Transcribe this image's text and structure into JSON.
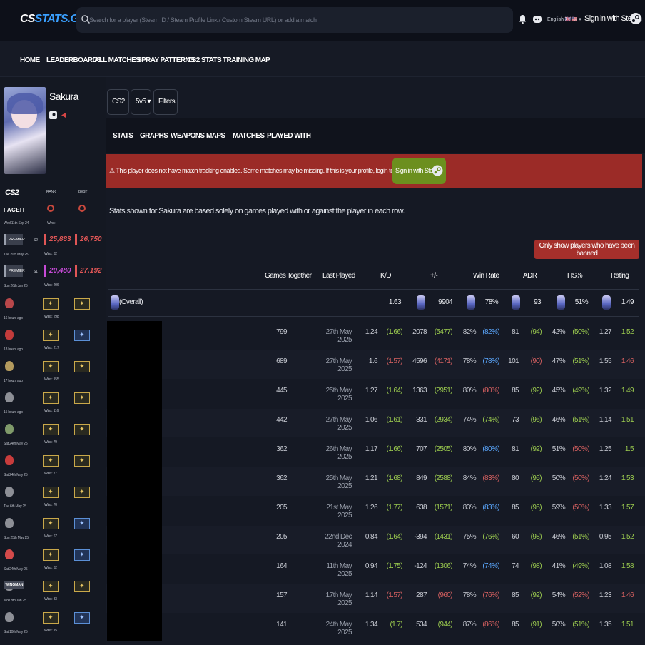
{
  "header": {
    "logo_cs": "CS",
    "logo_stats": "STATS.GG",
    "search_placeholder": "Search for a player (Steam ID / Steam Profile Link / Custom Steam URL) or add a match",
    "language": "English 🇬🇧🇺🇸 ▾",
    "signin": "Sign in with Steam"
  },
  "nav": [
    "HOME",
    "LEADERBOARDS",
    "ALL MATCHES",
    "SPRAY PATTERNS",
    "CS2 STATS",
    "TRAINING MAP"
  ],
  "profile": {
    "name": "Sakura",
    "cs2_label": "CS2",
    "rank_col": "RANK",
    "best_col": "BEST",
    "faceit_label": "FACEIT",
    "faceit_wins": "Wins:",
    "faceit_date": "Wed 11th Sep 24",
    "premier": [
      {
        "season": "S2",
        "rating": "25,883",
        "best": "26,750",
        "wins": "Wins: 32",
        "date": "Tue 20th May 25",
        "label": "PREMIER"
      },
      {
        "season": "S1",
        "rating": "20,480",
        "best": "27,192",
        "wins": "Wins: 206",
        "date": "Sun 26th Jan 25",
        "label": "PREMIER"
      }
    ],
    "maps": [
      {
        "date": "16 hours ago",
        "wins": "Wins: 298"
      },
      {
        "date": "18 hours ago",
        "wins": "Wins: 217"
      },
      {
        "date": "17 hours ago",
        "wins": "Wins: 155"
      },
      {
        "date": "15 hours ago",
        "wins": "Wins: 116"
      },
      {
        "date": "Sat 24th May 25",
        "wins": "Wins: 79"
      },
      {
        "date": "Sat 24th May 25",
        "wins": "Wins: 77"
      },
      {
        "date": "Tue 6th May 25",
        "wins": "Wins: 70"
      },
      {
        "date": "Sun 25th May 25",
        "wins": "Wins: 67"
      },
      {
        "date": "Sat 24th May 25",
        "wins": "Wins: 62"
      },
      {
        "date": "Mon 8th Jan 25",
        "wins": "Wins: 33"
      },
      {
        "date": "Sat 10th May 25",
        "wins": "Wins: 15"
      }
    ],
    "wingman_label": "WINGMAN"
  },
  "filters": {
    "game": "CS2 ▾",
    "mode": "5v5 ▾",
    "filters": "Filters ⋮"
  },
  "tabs": [
    "STATS",
    "GRAPHS",
    "WEAPONS",
    "MAPS",
    "MATCHES",
    "PLAYED WITH"
  ],
  "alert": {
    "text": "⚠ This player does not have match tracking enabled. Some matches may be missing. If this is your profile, login to set this up",
    "button": "Sign in with Steam"
  },
  "info": "Stats shown for Sakura are based solely on games played with or against the player in each row.",
  "banned_button": "Only show players who have been banned",
  "columns": [
    "Games Together",
    "Last Played",
    "K/D",
    "+/-",
    "Win Rate",
    "ADR",
    "HS%",
    "Rating"
  ],
  "overall": {
    "label": "(Overall)",
    "kd": "1.63",
    "pm": "9904",
    "wr": "78%",
    "adr": "93",
    "hs": "51%",
    "rating": "1.49"
  },
  "rows": [
    {
      "games": "799",
      "last": "27th May 2025",
      "kd": "1.24",
      "kd2": "(1.66)",
      "pm": "2078",
      "pm2": "(5477)",
      "wr": "82%",
      "wr2": "(82%)",
      "adr": "81",
      "adr2": "(94)",
      "hs": "42%",
      "hs2": "(50%)",
      "r": "1.27",
      "r2": "1.52"
    },
    {
      "games": "689",
      "last": "27th May 2025",
      "kd": "1.6",
      "kd2": "(1.57)",
      "pm": "4596",
      "pm2": "(4171)",
      "wr": "78%",
      "wr2": "(78%)",
      "adr": "101",
      "adr2": "(90)",
      "hs": "47%",
      "hs2": "(51%)",
      "r": "1.55",
      "r2": "1.46"
    },
    {
      "games": "445",
      "last": "25th May 2025",
      "kd": "1.27",
      "kd2": "(1.64)",
      "pm": "1363",
      "pm2": "(2951)",
      "wr": "80%",
      "wr2": "(80%)",
      "adr": "85",
      "adr2": "(92)",
      "hs": "45%",
      "hs2": "(49%)",
      "r": "1.32",
      "r2": "1.49"
    },
    {
      "games": "442",
      "last": "27th May 2025",
      "kd": "1.06",
      "kd2": "(1.61)",
      "pm": "331",
      "pm2": "(2934)",
      "wr": "74%",
      "wr2": "(74%)",
      "adr": "73",
      "adr2": "(96)",
      "hs": "46%",
      "hs2": "(51%)",
      "r": "1.14",
      "r2": "1.51"
    },
    {
      "games": "362",
      "last": "26th May 2025",
      "kd": "1.17",
      "kd2": "(1.66)",
      "pm": "707",
      "pm2": "(2505)",
      "wr": "80%",
      "wr2": "(80%)",
      "adr": "81",
      "adr2": "(92)",
      "hs": "51%",
      "hs2": "(50%)",
      "r": "1.25",
      "r2": "1.5"
    },
    {
      "games": "362",
      "last": "25th May 2025",
      "kd": "1.21",
      "kd2": "(1.68)",
      "pm": "849",
      "pm2": "(2588)",
      "wr": "84%",
      "wr2": "(83%)",
      "adr": "80",
      "adr2": "(95)",
      "hs": "50%",
      "hs2": "(50%)",
      "r": "1.24",
      "r2": "1.53"
    },
    {
      "games": "205",
      "last": "21st May 2025",
      "kd": "1.26",
      "kd2": "(1.77)",
      "pm": "638",
      "pm2": "(1571)",
      "wr": "83%",
      "wr2": "(83%)",
      "adr": "85",
      "adr2": "(95)",
      "hs": "59%",
      "hs2": "(50%)",
      "r": "1.33",
      "r2": "1.57"
    },
    {
      "games": "205",
      "last": "22nd Dec 2024",
      "kd": "0.84",
      "kd2": "(1.64)",
      "pm": "-394",
      "pm2": "(1431)",
      "wr": "75%",
      "wr2": "(76%)",
      "adr": "60",
      "adr2": "(98)",
      "hs": "46%",
      "hs2": "(51%)",
      "r": "0.95",
      "r2": "1.52"
    },
    {
      "games": "164",
      "last": "11th May 2025",
      "kd": "0.94",
      "kd2": "(1.75)",
      "pm": "-124",
      "pm2": "(1306)",
      "wr": "74%",
      "wr2": "(74%)",
      "adr": "74",
      "adr2": "(98)",
      "hs": "41%",
      "hs2": "(49%)",
      "r": "1.08",
      "r2": "1.58"
    },
    {
      "games": "157",
      "last": "17th May 2025",
      "kd": "1.14",
      "kd2": "(1.57)",
      "pm": "287",
      "pm2": "(960)",
      "wr": "78%",
      "wr2": "(76%)",
      "adr": "85",
      "adr2": "(92)",
      "hs": "54%",
      "hs2": "(52%)",
      "r": "1.23",
      "r2": "1.46"
    },
    {
      "games": "141",
      "last": "24th May 2025",
      "kd": "1.34",
      "kd2": "(1.7)",
      "pm": "534",
      "pm2": "(944)",
      "wr": "87%",
      "wr2": "(86%)",
      "adr": "85",
      "adr2": "(91)",
      "hs": "50%",
      "hs2": "(51%)",
      "r": "1.35",
      "r2": "1.51"
    }
  ],
  "colors": {
    "green": "#9ccc4f",
    "red": "#d66060",
    "blue": "#5ba8ff",
    "alert": "#9b2b27",
    "steam_btn": "#6c8f1e"
  }
}
